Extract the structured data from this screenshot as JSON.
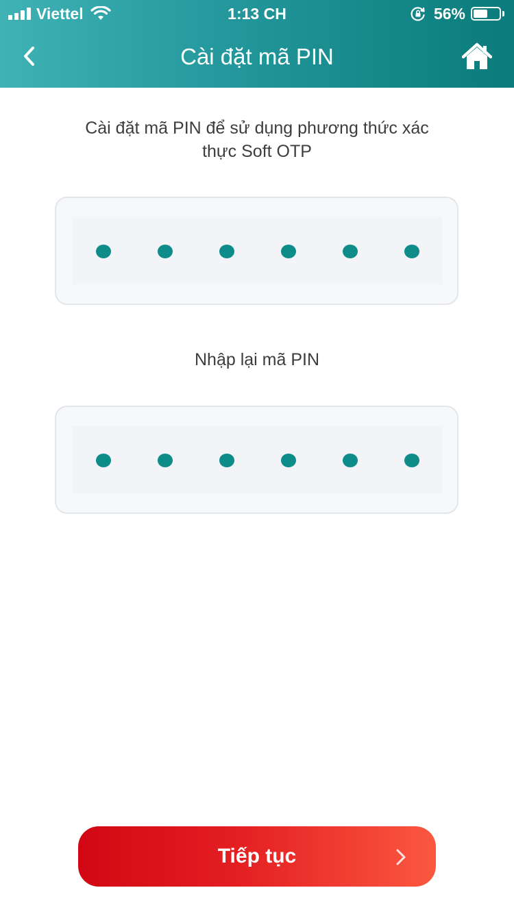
{
  "status_bar": {
    "carrier": "Viettel",
    "time": "1:13 CH",
    "battery_percent_text": "56%",
    "battery_level": 0.56
  },
  "header": {
    "title": "Cài đặt mã PIN",
    "back_icon": "chevron-left-icon",
    "home_icon": "home-icon",
    "gradient_colors": [
      "#3fb2b6",
      "#0b7b7b"
    ]
  },
  "form": {
    "instruction": "Cài đặt mã PIN để sử dụng phương thức xác thực Soft OTP",
    "confirm_label": "Nhập lại mã PIN",
    "pin_length": 6,
    "pin_filled": 6,
    "confirm_pin_filled": 6,
    "dot_color": "#0e8c8a"
  },
  "footer": {
    "continue_label": "Tiếp tục",
    "continue_icon": "chevron-right-icon",
    "button_gradient": [
      "#d10814",
      "#fb5840"
    ]
  }
}
